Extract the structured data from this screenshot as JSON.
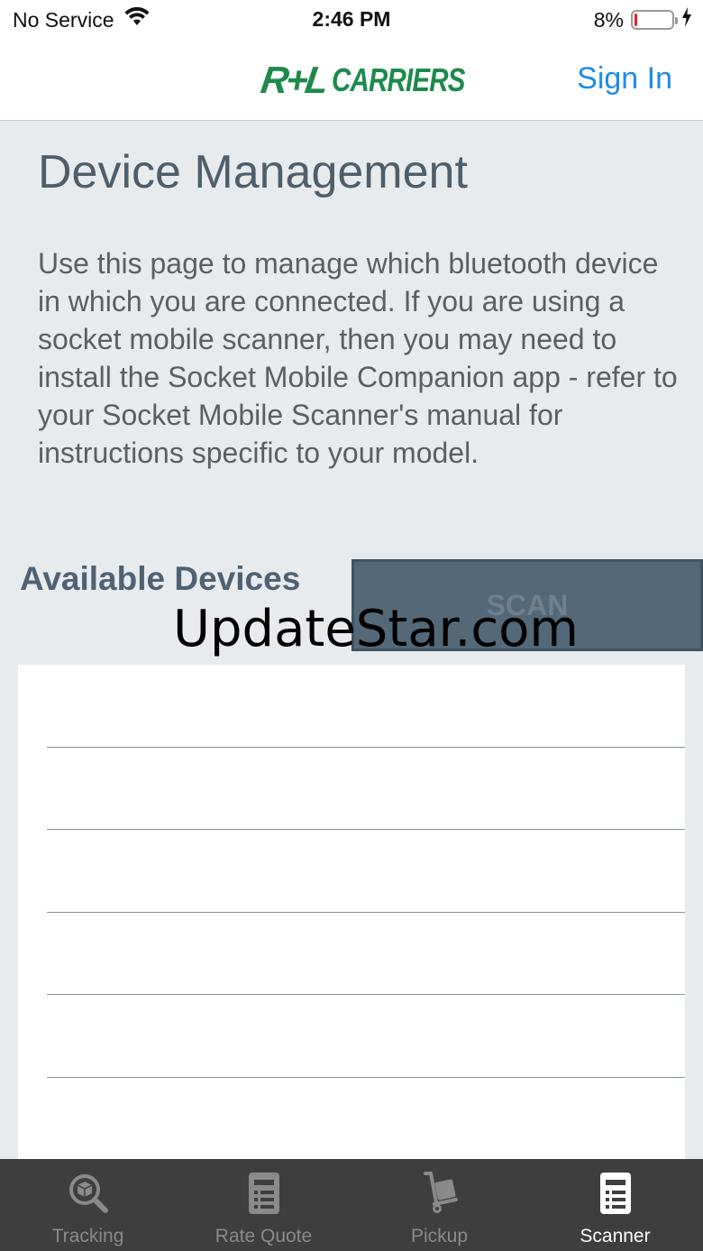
{
  "status_bar": {
    "carrier": "No Service",
    "time": "2:46 PM",
    "battery_percent": "8%",
    "battery_level": 0.08,
    "icons": [
      "wifi-icon",
      "battery-icon",
      "charging-bolt-icon"
    ]
  },
  "header": {
    "logo_mark": "R+L",
    "logo_word": "CARRIERS",
    "sign_in_label": "Sign In",
    "brand_color": "#1d8a4b",
    "link_color": "#1e8ce6"
  },
  "main": {
    "title": "Device Management",
    "description": "Use this page to manage which bluetooth device in which you are connected. If you are using a socket mobile scanner, then you may need to install the Socket Mobile Companion app - refer to your Socket Mobile Scanner's manual for instructions specific to your model.",
    "available_devices_heading": "Available Devices",
    "scan_label": "SCAN",
    "devices": [
      "",
      "",
      "",
      "",
      "",
      ""
    ]
  },
  "watermark": "UpdateStar.com",
  "tab_bar": {
    "tabs": [
      {
        "label": "Tracking",
        "icon": "tracking-search-box-icon",
        "active": false
      },
      {
        "label": "Rate Quote",
        "icon": "rate-quote-document-icon",
        "active": false
      },
      {
        "label": "Pickup",
        "icon": "pickup-hand-truck-icon",
        "active": false
      },
      {
        "label": "Scanner",
        "icon": "scanner-document-icon",
        "active": true
      }
    ]
  }
}
